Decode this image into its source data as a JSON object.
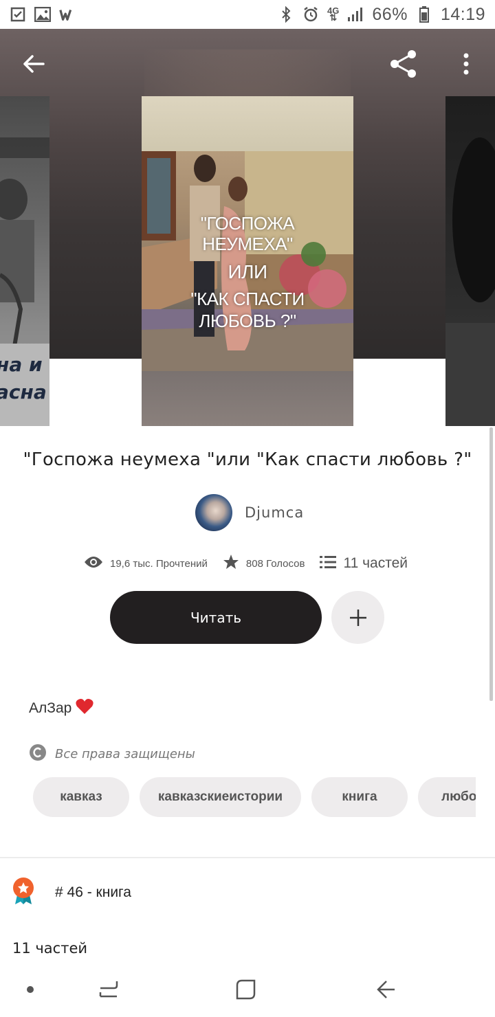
{
  "status_bar": {
    "battery_percent": "66%",
    "time": "14:19",
    "network": "4G"
  },
  "book": {
    "title": "\"Госпожа неумеха \"или \"Как спасти любовь ?\"",
    "cover_text": [
      "\"ГОСПОЖА",
      "НЕУМЕХА\"",
      "ИЛИ",
      "\"КАК СПАСТИ",
      "ЛЮБОВЬ ?\""
    ],
    "left_cover_text": [
      "на и",
      "асна"
    ],
    "author": "Djumca",
    "reads": "19,6 тыс. Прочтений",
    "votes": "808 Голосов",
    "parts": "11 частей",
    "read_button": "Читать",
    "description": "АлЗар",
    "rights": "Все права защищены",
    "tags": [
      "кавказ",
      "кавказскиеистории",
      "книга",
      "любовь"
    ],
    "rank": "# 46 - книга",
    "parts_heading": "11 частей"
  },
  "colors": {
    "primary_button": "#221f20",
    "chip_bg": "#eeeced",
    "heart": "#e0282e",
    "rank_badge": "#f0622d"
  }
}
